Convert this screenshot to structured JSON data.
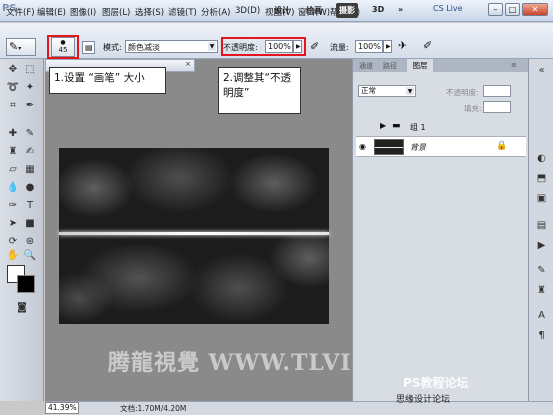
{
  "menubar": {
    "app_logo": "PS",
    "items": [
      "文件(F)",
      "编辑(E)",
      "图像(I)",
      "图层(L)",
      "选择(S)",
      "滤镜(T)",
      "分析(A)",
      "3D(D)",
      "视图(V)",
      "窗口(W)",
      "帮助(H)"
    ],
    "workspaces": [
      "设计",
      "绘画",
      "摄影",
      "3D"
    ],
    "active_workspace": "摄影",
    "cs_live": "CS Live"
  },
  "options": {
    "brush_size": "45",
    "mode_label": "模式:",
    "mode_value": "颜色减淡",
    "opacity_label": "不透明度:",
    "opacity_value": "100%",
    "flow_label": "流量:",
    "flow_value": "100%"
  },
  "document": {
    "tab_title": "",
    "zoom": "41.39%",
    "info": "文档:1.70M/4.20M"
  },
  "callouts": {
    "one": "1.设置 “画笔” 大小",
    "two": "2.调整其“不透明度”"
  },
  "layers_panel": {
    "tabs": [
      "通道",
      "路径",
      "图层"
    ],
    "active_tab": "图层",
    "blend_mode": "正常",
    "opacity_label": "不透明度:",
    "fill_label": "填充:",
    "layers": [
      {
        "name": "组 1",
        "type": "group"
      },
      {
        "name": "背景",
        "type": "background",
        "locked": true
      }
    ]
  },
  "watermark": "腾龍視覺 WWW.TLVI.NET",
  "site_logo": "PS教程论坛",
  "site_logo_sub": "思缘设计论坛"
}
